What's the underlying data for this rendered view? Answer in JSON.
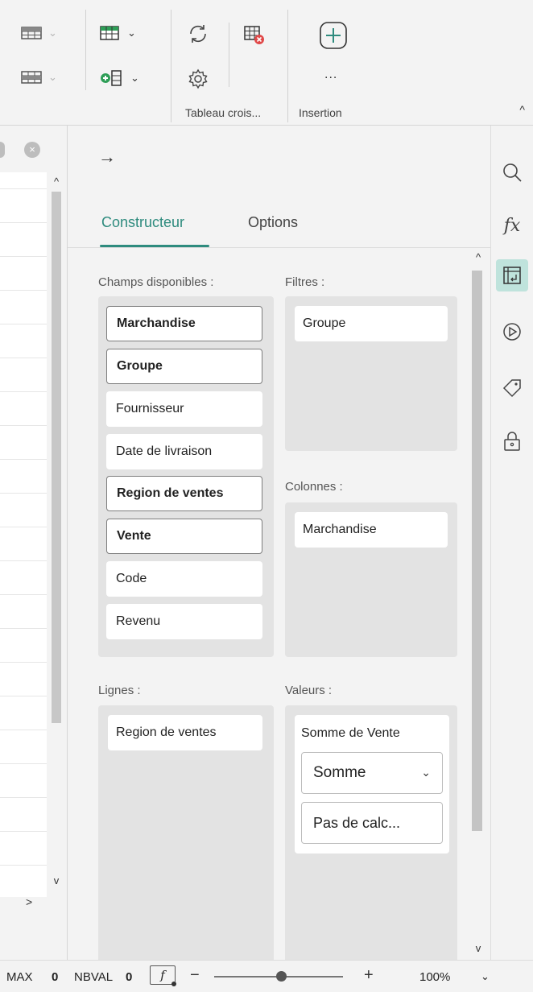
{
  "ribbon": {
    "groups": {
      "pivot_label": "Tableau crois...",
      "insert_label": "Insertion"
    },
    "insert_more": "...",
    "collapse_glyph": "^",
    "icons": [
      "table-layout-icon",
      "table-subtotal-icon",
      "table-style-icon",
      "add-column-icon",
      "refresh-icon",
      "settings-icon",
      "delete-table-icon",
      "insert-plus-icon"
    ]
  },
  "sheet": {
    "close_glyph": "×",
    "scroll_up": "^",
    "scroll_down": "v",
    "scroll_right": ">"
  },
  "panel": {
    "back_arrow": "→",
    "tabs": [
      {
        "label": "Constructeur",
        "active": true
      },
      {
        "label": "Options",
        "active": false
      }
    ],
    "available": {
      "label": "Champs disponibles :",
      "fields": [
        {
          "label": "Marchandise",
          "selected": true
        },
        {
          "label": "Groupe",
          "selected": true
        },
        {
          "label": "Fournisseur",
          "selected": false
        },
        {
          "label": "Date de livraison",
          "selected": false
        },
        {
          "label": "Region de ventes",
          "selected": true
        },
        {
          "label": "Vente",
          "selected": true
        },
        {
          "label": "Code",
          "selected": false
        },
        {
          "label": "Revenu",
          "selected": false
        }
      ]
    },
    "filters": {
      "label": "Filtres :",
      "items": [
        "Groupe"
      ]
    },
    "columns": {
      "label": "Colonnes :",
      "items": [
        "Marchandise"
      ]
    },
    "rows": {
      "label": "Lignes :",
      "items": [
        "Region de ventes"
      ]
    },
    "values": {
      "label": "Valeurs :",
      "item_title": "Somme de Vente",
      "function_select": "Somme",
      "calc_select": "Pas de calc..."
    },
    "scroll_up": "^",
    "scroll_down": "v"
  },
  "sidebar": {
    "icons": [
      "search-icon",
      "function-icon",
      "pivot-table-icon",
      "play-icon",
      "tag-icon",
      "lock-icon"
    ],
    "active": "pivot-table-icon",
    "fx_label": "fx"
  },
  "status": {
    "max_label": "MAX",
    "max_value": "0",
    "nbval_label": "NBVAL",
    "nbval_value": "0",
    "fx_box": "f",
    "zoom_minus": "−",
    "zoom_plus": "+",
    "zoom": "100%",
    "zoom_level": 0.5,
    "zoom_caret": "⌄"
  },
  "colors": {
    "accent": "#2e8b7e",
    "active_sidebar_bg": "#bfe3dc",
    "delete_badge": "#e04848",
    "green_plus": "#2e9e57"
  }
}
